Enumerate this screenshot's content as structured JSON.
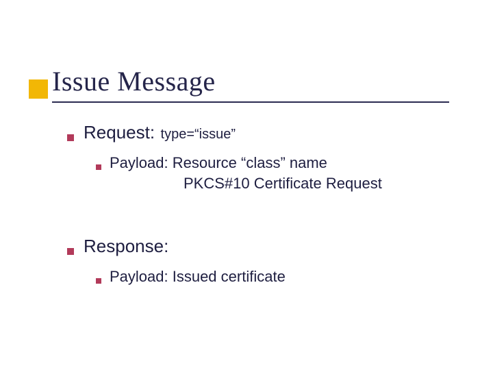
{
  "slide": {
    "title": "Issue Message",
    "bullets": [
      {
        "label": "Request:",
        "suffix": "type=“issue”",
        "children": [
          {
            "line1": "Payload: Resource “class” name",
            "line2": "PKCS#10 Certificate Request"
          }
        ]
      },
      {
        "label": "Response:",
        "suffix": "",
        "children": [
          {
            "line1": "Payload: Issued certificate",
            "line2": ""
          }
        ]
      }
    ],
    "colors": {
      "accent_block": "#f2b705",
      "bullet": "#b23a5a",
      "text": "#1e1e40",
      "underline": "#2a2a50"
    }
  }
}
